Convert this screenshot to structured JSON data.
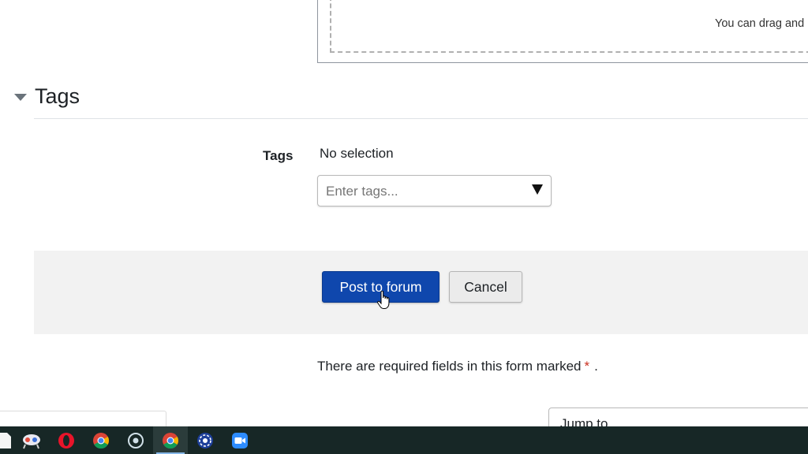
{
  "dropzone": {
    "hint": "You can drag and"
  },
  "tags_section": {
    "title": "Tags",
    "field_label": "Tags",
    "selection_status": "No selection",
    "input_placeholder": "Enter tags..."
  },
  "actions": {
    "submit_label": "Post to forum",
    "cancel_label": "Cancel"
  },
  "required_notice": {
    "text": "There are required fields in this form marked",
    "marker": "*",
    "end": "."
  },
  "footer": {
    "jump_to": "Jump to..."
  },
  "colors": {
    "primary_button": "#0f47ad",
    "required_marker": "#ca3120",
    "taskbar": "#172726"
  },
  "taskbar": {
    "items": [
      {
        "icon": "file-icon"
      },
      {
        "icon": "snipping-tool-icon"
      },
      {
        "icon": "opera-icon"
      },
      {
        "icon": "chrome-icon"
      },
      {
        "icon": "circle-app-icon"
      },
      {
        "icon": "chrome-icon",
        "active": true
      },
      {
        "icon": "media-app-icon"
      },
      {
        "icon": "zoom-icon"
      }
    ]
  }
}
